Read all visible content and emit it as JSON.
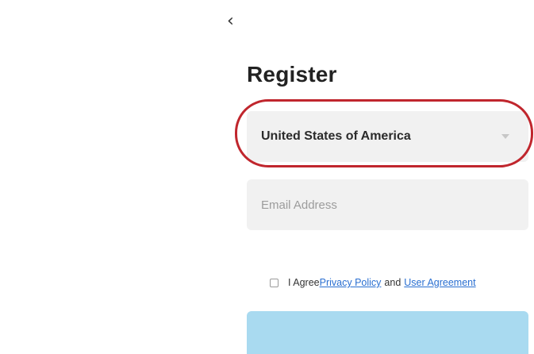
{
  "header": {
    "back_icon": "chevron-left-icon",
    "back_glyph": "‹",
    "title": "Register"
  },
  "form": {
    "country": {
      "value": "United States of America",
      "icon": "caret-down-icon"
    },
    "email": {
      "placeholder": "Email Address",
      "value": ""
    },
    "agreement": {
      "checked": false,
      "prefix": "I Agree",
      "privacy_link": "Privacy Policy",
      "conjunction": "and",
      "user_agreement_link": "User Agreement"
    },
    "submit": {
      "label": ""
    }
  },
  "annotation": {
    "highlight_color": "#c0262d",
    "highlight_target": "country-field"
  },
  "colors": {
    "field_background": "#f1f1f1",
    "link": "#2a6fd1",
    "button_disabled": "#a9daf0"
  }
}
